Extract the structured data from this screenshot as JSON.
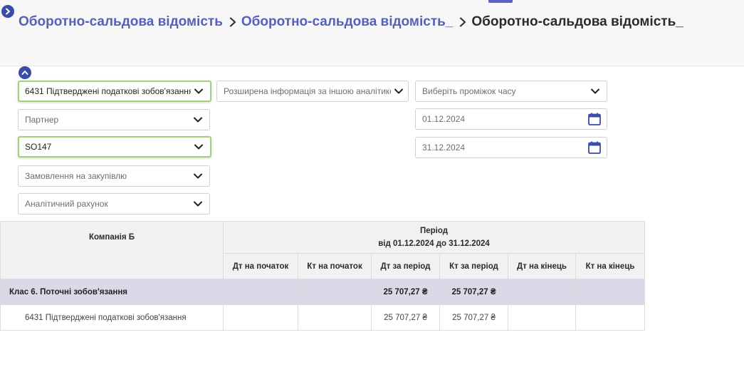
{
  "breadcrumb": {
    "item1": "Оборотно-сальдова відомість",
    "item2": "Оборотно-сальдова відомість_",
    "current": "Оборотно-сальдова відомість_"
  },
  "filters": {
    "account": "6431 Підтверджені податкові зобов'язання",
    "partner_placeholder": "Партнер",
    "document": "SO147",
    "purchase_order_placeholder": "Замовлення на закупівлю",
    "analytic_account_placeholder": "Аналітичний рахунок",
    "extended_info_placeholder": "Розширена інформація за іншою аналітико",
    "period_placeholder": "Виберіть проміжок часу",
    "date_from": "01.12.2024",
    "date_to": "31.12.2024"
  },
  "table": {
    "company": "Компанія Б",
    "period_title": "Період",
    "period_range": "від 01.12.2024 до 31.12.2024",
    "columns": [
      "Дт на початок",
      "Кт на початок",
      "Дт за період",
      "Кт за період",
      "Дт на кінець",
      "Кт на кінець"
    ],
    "class_row": {
      "label": "Клас 6. Поточні зобов'язання",
      "values": [
        "",
        "",
        "25 707,27 ₴",
        "25 707,27 ₴",
        "",
        ""
      ]
    },
    "item_row": {
      "label": "6431 Підтверджені податкові зобов'язання",
      "values": [
        "",
        "",
        "25 707,27 ₴",
        "25 707,27 ₴",
        "",
        ""
      ]
    }
  },
  "colors": {
    "accent": "#5560b8",
    "selected_border": "#a5d07a",
    "class_row_bg": "#dbd9e8"
  }
}
